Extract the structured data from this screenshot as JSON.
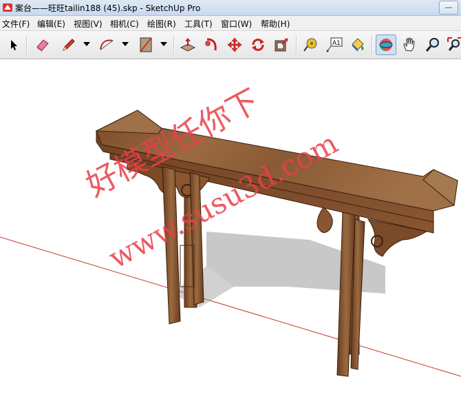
{
  "window": {
    "title": "案台——旺旺tailin188 (45).skp - SketchUp Pro",
    "buttons": {
      "minimize": "—"
    }
  },
  "menu": [
    {
      "label": "文件(F)"
    },
    {
      "label": "编辑(E)"
    },
    {
      "label": "视图(V)"
    },
    {
      "label": "相机(C)"
    },
    {
      "label": "绘图(R)"
    },
    {
      "label": "工具(T)"
    },
    {
      "label": "窗口(W)"
    },
    {
      "label": "帮助(H)"
    }
  ],
  "toolbar": {
    "tools": [
      {
        "name": "select-tool-icon"
      },
      {
        "name": "eraser-tool-icon"
      },
      {
        "name": "pencil-line-tool-icon"
      },
      {
        "name": "arc-tool-icon"
      },
      {
        "name": "rectangle-tool-icon"
      },
      {
        "name": "push-pull-tool-icon"
      },
      {
        "name": "follow-me-tool-icon"
      },
      {
        "name": "move-tool-icon"
      },
      {
        "name": "rotate-tool-icon"
      },
      {
        "name": "offset-tool-icon"
      },
      {
        "name": "tape-measure-tool-icon"
      },
      {
        "name": "text-tool-icon"
      },
      {
        "name": "paint-bucket-tool-icon"
      },
      {
        "name": "orbit-tool-icon"
      },
      {
        "name": "pan-tool-icon"
      },
      {
        "name": "zoom-tool-icon"
      },
      {
        "name": "zoom-extents-tool-icon"
      }
    ],
    "active_tool": "orbit-tool-icon",
    "text_tool_label": "A1"
  },
  "watermark": {
    "line1": "好模型任你下",
    "line2": "www.susu3d.com"
  },
  "colors": {
    "wood": "#8a5a34",
    "watermark": "#e8404a",
    "axis_red": "#c0392b"
  }
}
